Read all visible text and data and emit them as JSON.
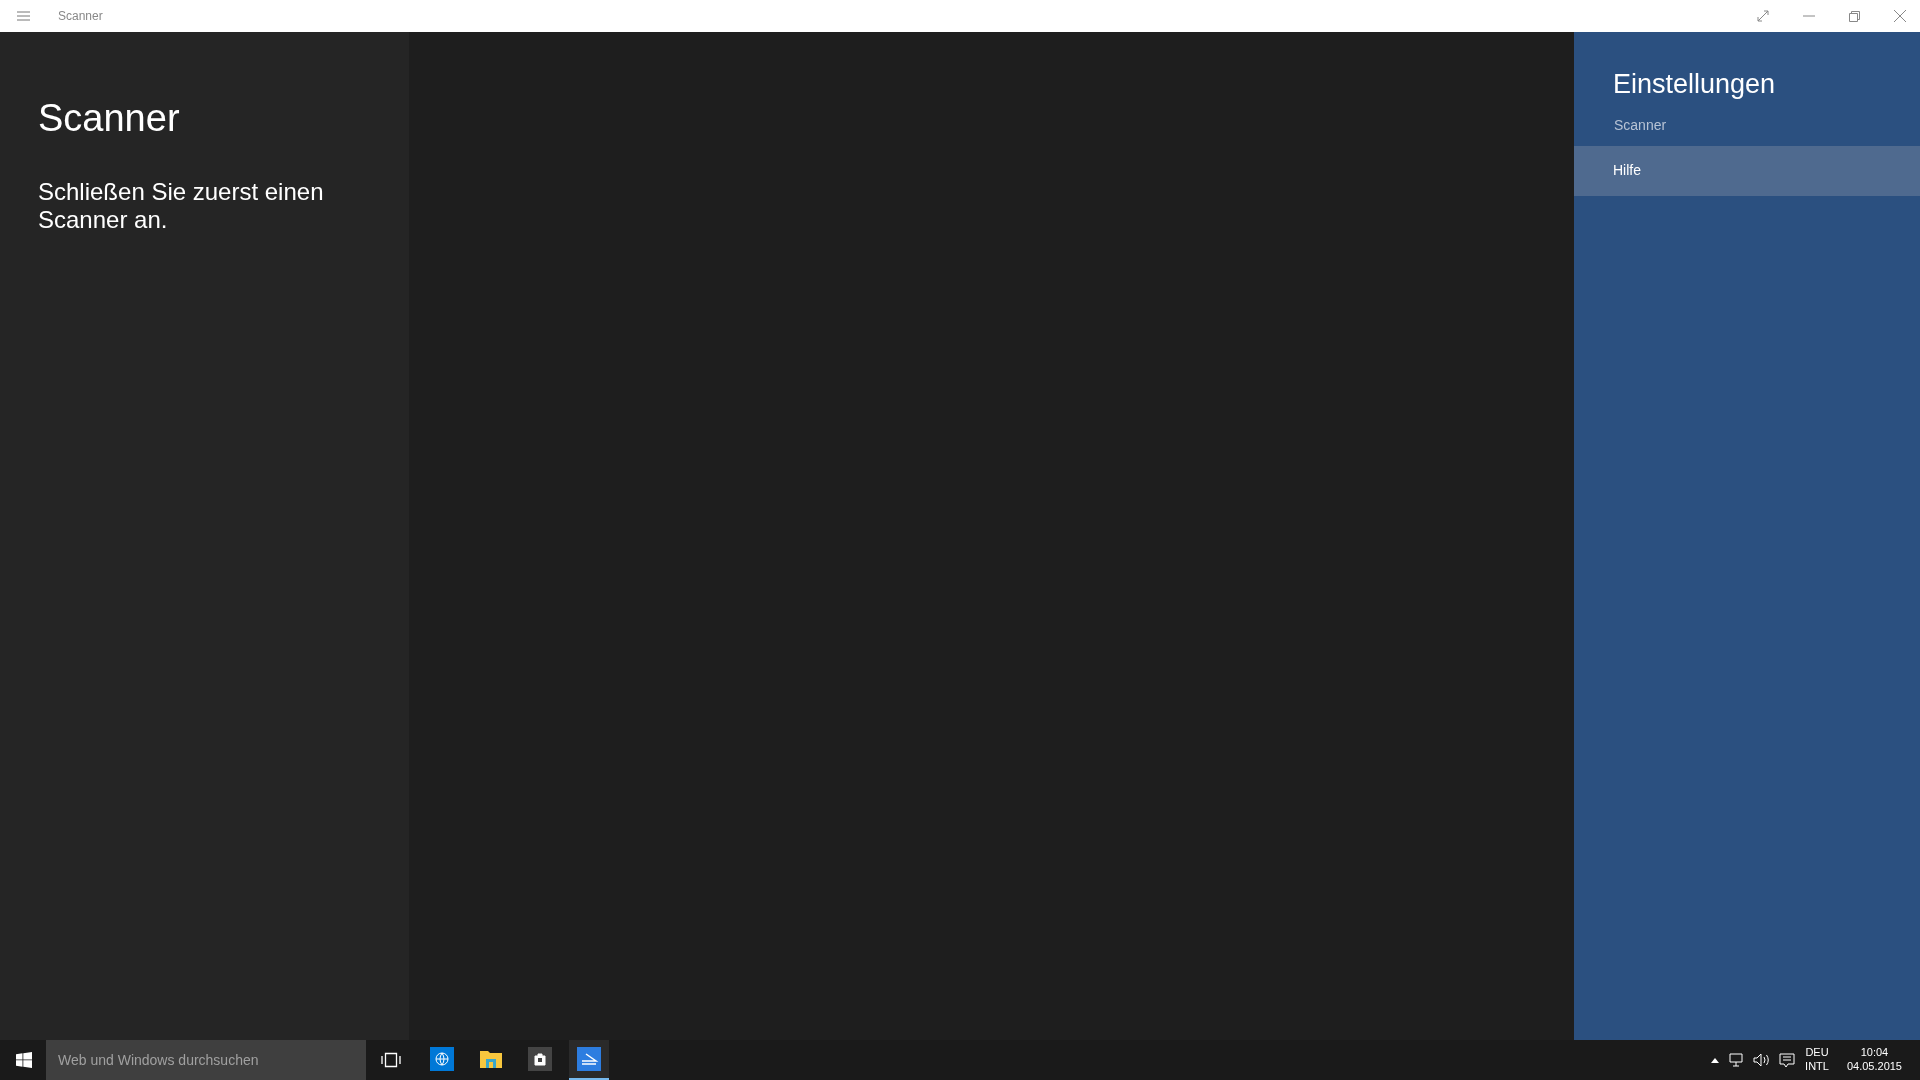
{
  "window": {
    "title": "Scanner"
  },
  "left_panel": {
    "title": "Scanner",
    "message": "Schließen Sie zuerst einen Scanner an."
  },
  "settings": {
    "title": "Einstellungen",
    "subtitle": "Scanner",
    "items": [
      {
        "label": "Hilfe",
        "selected": true
      }
    ]
  },
  "taskbar": {
    "search": {
      "placeholder": "Web und Windows durchsuchen"
    },
    "apps": [
      {
        "kind": "globe",
        "active": false
      },
      {
        "kind": "folder",
        "active": false
      },
      {
        "kind": "store",
        "active": false
      },
      {
        "kind": "scanner",
        "active": true
      }
    ],
    "tray": {
      "language": "DEU",
      "layout": "INTL",
      "time": "10:04",
      "date": "04.05.2015"
    }
  }
}
